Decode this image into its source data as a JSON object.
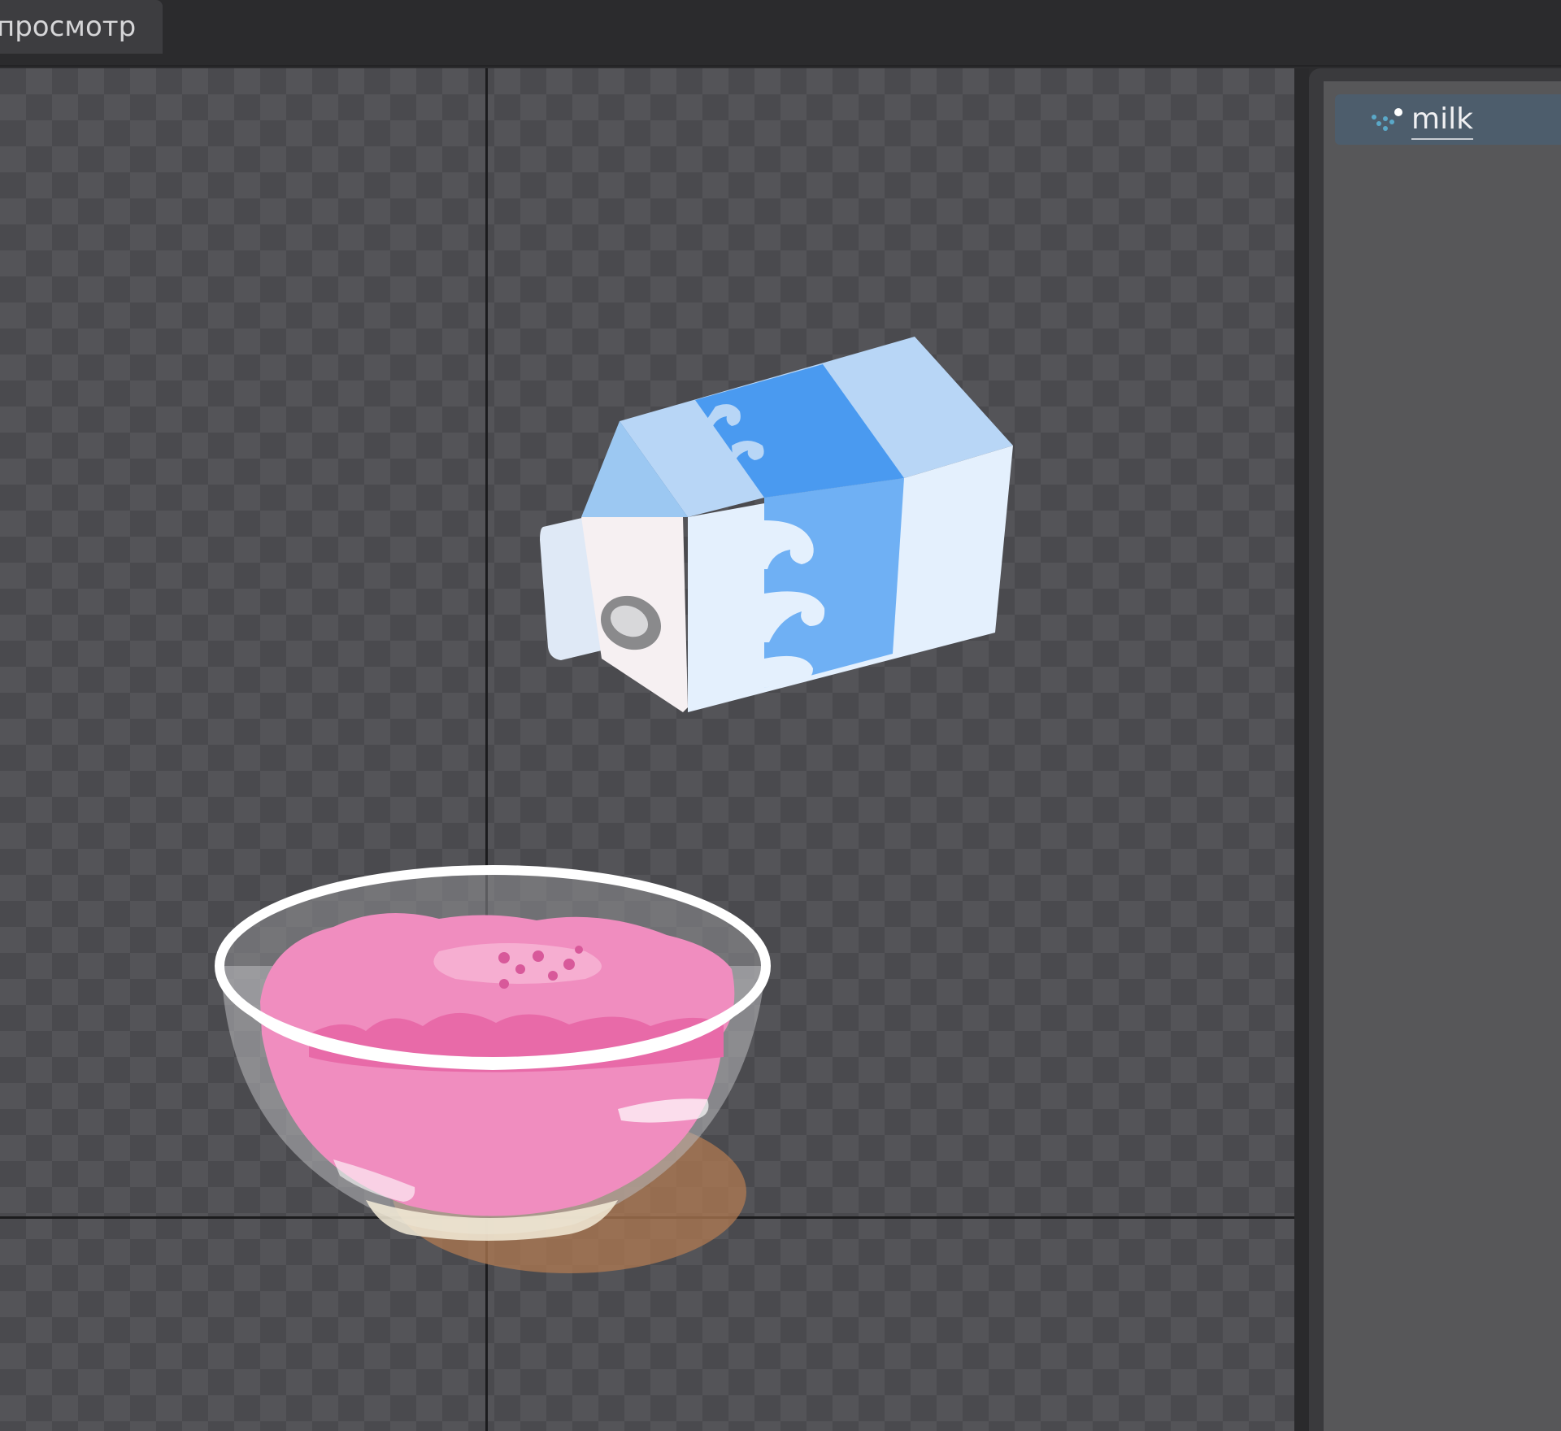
{
  "tab": {
    "label": "просмотр"
  },
  "hierarchy": {
    "items": [
      {
        "label": "milk",
        "icon": "particles-icon",
        "selected": true
      }
    ]
  },
  "colors": {
    "selection": "#4d5d6c",
    "carton_blue": "#4a9af0",
    "bowl_pink": "#f08dbf"
  }
}
